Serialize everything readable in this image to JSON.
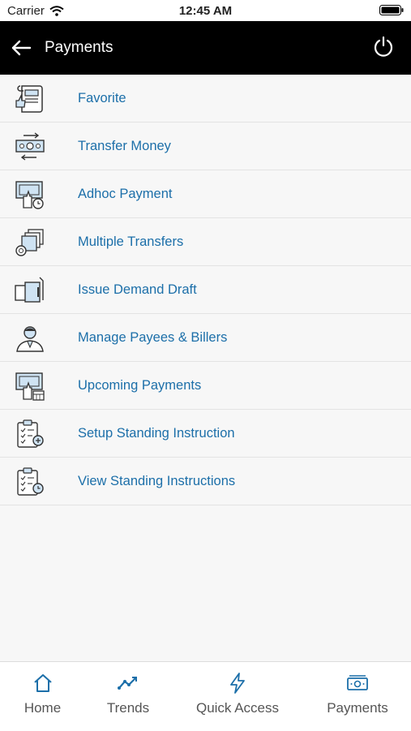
{
  "status_bar": {
    "carrier": "Carrier",
    "time": "12:45 AM"
  },
  "header": {
    "title": "Payments"
  },
  "menu": [
    {
      "label": "Favorite",
      "icon": "favorite-document-icon"
    },
    {
      "label": "Transfer Money",
      "icon": "transfer-money-icon"
    },
    {
      "label": "Adhoc Payment",
      "icon": "adhoc-payment-icon"
    },
    {
      "label": "Multiple Transfers",
      "icon": "multiple-transfers-icon"
    },
    {
      "label": "Issue Demand Draft",
      "icon": "demand-draft-icon"
    },
    {
      "label": "Manage Payees & Billers",
      "icon": "payee-person-icon"
    },
    {
      "label": "Upcoming Payments",
      "icon": "upcoming-payments-icon"
    },
    {
      "label": "Setup Standing Instruction",
      "icon": "clipboard-add-icon"
    },
    {
      "label": "View Standing Instructions",
      "icon": "clipboard-clock-icon"
    }
  ],
  "tabs": [
    {
      "label": "Home",
      "icon": "home-icon"
    },
    {
      "label": "Trends",
      "icon": "trends-icon"
    },
    {
      "label": "Quick Access",
      "icon": "lightning-icon"
    },
    {
      "label": "Payments",
      "icon": "payments-cash-icon"
    }
  ],
  "colors": {
    "accent": "#1c6fa9",
    "icon_fill": "#cfe3f3",
    "header_bg": "#000000",
    "background": "#f7f7f7"
  }
}
